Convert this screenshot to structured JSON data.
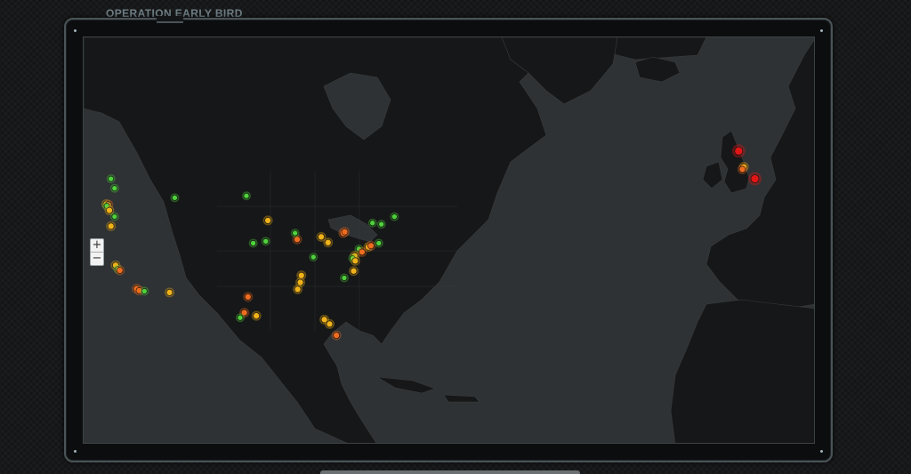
{
  "app": {
    "title": "OPERATION EARLY BIRD"
  },
  "zoom": {
    "in_label": "+",
    "out_label": "−"
  },
  "legend_colors": {
    "map_background": "#2f3234",
    "land": "#161718",
    "border": "#3a3c3e",
    "marker_green": "#4fd23c",
    "marker_yellow": "#f0b21a",
    "marker_orange": "#ef6c1f",
    "marker_red": "#e31616"
  },
  "markers": [
    {
      "lat": 51.5,
      "lon": -123.2,
      "status": "green"
    },
    {
      "lat": 50.0,
      "lon": -122.5,
      "status": "green"
    },
    {
      "lat": 48.5,
      "lon": -111.0,
      "status": "green"
    },
    {
      "lat": 47.5,
      "lon": -124.1,
      "status": "yellow"
    },
    {
      "lat": 47.4,
      "lon": -123.7,
      "status": "orange"
    },
    {
      "lat": 47.2,
      "lon": -124.0,
      "status": "green"
    },
    {
      "lat": 46.5,
      "lon": -123.5,
      "status": "yellow"
    },
    {
      "lat": 45.5,
      "lon": -122.5,
      "status": "green"
    },
    {
      "lat": 44.0,
      "lon": -123.2,
      "status": "yellow"
    },
    {
      "lat": 37.8,
      "lon": -122.3,
      "status": "yellow"
    },
    {
      "lat": 37.2,
      "lon": -121.9,
      "status": "green"
    },
    {
      "lat": 37.0,
      "lon": -121.5,
      "status": "orange"
    },
    {
      "lat": 34.1,
      "lon": -118.3,
      "status": "orange"
    },
    {
      "lat": 33.8,
      "lon": -117.8,
      "status": "orange"
    },
    {
      "lat": 33.7,
      "lon": -116.8,
      "status": "green"
    },
    {
      "lat": 33.5,
      "lon": -112.0,
      "status": "yellow"
    },
    {
      "lat": 48.8,
      "lon": -97.3,
      "status": "green"
    },
    {
      "lat": 44.9,
      "lon": -93.2,
      "status": "yellow"
    },
    {
      "lat": 41.6,
      "lon": -93.6,
      "status": "green"
    },
    {
      "lat": 41.3,
      "lon": -96.0,
      "status": "green"
    },
    {
      "lat": 41.9,
      "lon": -87.6,
      "status": "orange"
    },
    {
      "lat": 42.9,
      "lon": -88.0,
      "status": "green"
    },
    {
      "lat": 39.1,
      "lon": -84.5,
      "status": "green"
    },
    {
      "lat": 42.3,
      "lon": -83.0,
      "status": "yellow"
    },
    {
      "lat": 42.9,
      "lon": -78.8,
      "status": "orange"
    },
    {
      "lat": 43.1,
      "lon": -78.5,
      "status": "orange"
    },
    {
      "lat": 41.4,
      "lon": -81.7,
      "status": "yellow"
    },
    {
      "lat": 44.5,
      "lon": -73.2,
      "status": "green"
    },
    {
      "lat": 44.3,
      "lon": -71.5,
      "status": "green"
    },
    {
      "lat": 45.5,
      "lon": -69.0,
      "status": "green"
    },
    {
      "lat": 40.4,
      "lon": -75.8,
      "status": "green"
    },
    {
      "lat": 40.7,
      "lon": -74.0,
      "status": "yellow"
    },
    {
      "lat": 40.9,
      "lon": -73.5,
      "status": "orange"
    },
    {
      "lat": 41.3,
      "lon": -72.0,
      "status": "green"
    },
    {
      "lat": 39.9,
      "lon": -75.2,
      "status": "orange"
    },
    {
      "lat": 39.3,
      "lon": -76.6,
      "status": "yellow"
    },
    {
      "lat": 38.9,
      "lon": -77.0,
      "status": "green"
    },
    {
      "lat": 38.5,
      "lon": -76.5,
      "status": "yellow"
    },
    {
      "lat": 36.9,
      "lon": -76.8,
      "status": "yellow"
    },
    {
      "lat": 35.8,
      "lon": -78.6,
      "status": "green"
    },
    {
      "lat": 36.2,
      "lon": -86.8,
      "status": "yellow"
    },
    {
      "lat": 35.1,
      "lon": -87.0,
      "status": "yellow"
    },
    {
      "lat": 34.0,
      "lon": -87.5,
      "status": "yellow"
    },
    {
      "lat": 32.8,
      "lon": -97.0,
      "status": "orange"
    },
    {
      "lat": 30.3,
      "lon": -97.7,
      "status": "orange"
    },
    {
      "lat": 29.8,
      "lon": -95.4,
      "status": "yellow"
    },
    {
      "lat": 29.5,
      "lon": -98.5,
      "status": "green"
    },
    {
      "lat": 29.2,
      "lon": -82.4,
      "status": "yellow"
    },
    {
      "lat": 28.5,
      "lon": -81.4,
      "status": "yellow"
    },
    {
      "lat": 26.7,
      "lon": -80.1,
      "status": "orange"
    },
    {
      "lat": 55.9,
      "lon": -3.2,
      "status": "red"
    },
    {
      "lat": 53.4,
      "lon": -2.2,
      "status": "yellow"
    },
    {
      "lat": 53.0,
      "lon": -2.5,
      "status": "orange"
    },
    {
      "lat": 51.5,
      "lon": -0.1,
      "status": "red"
    }
  ]
}
